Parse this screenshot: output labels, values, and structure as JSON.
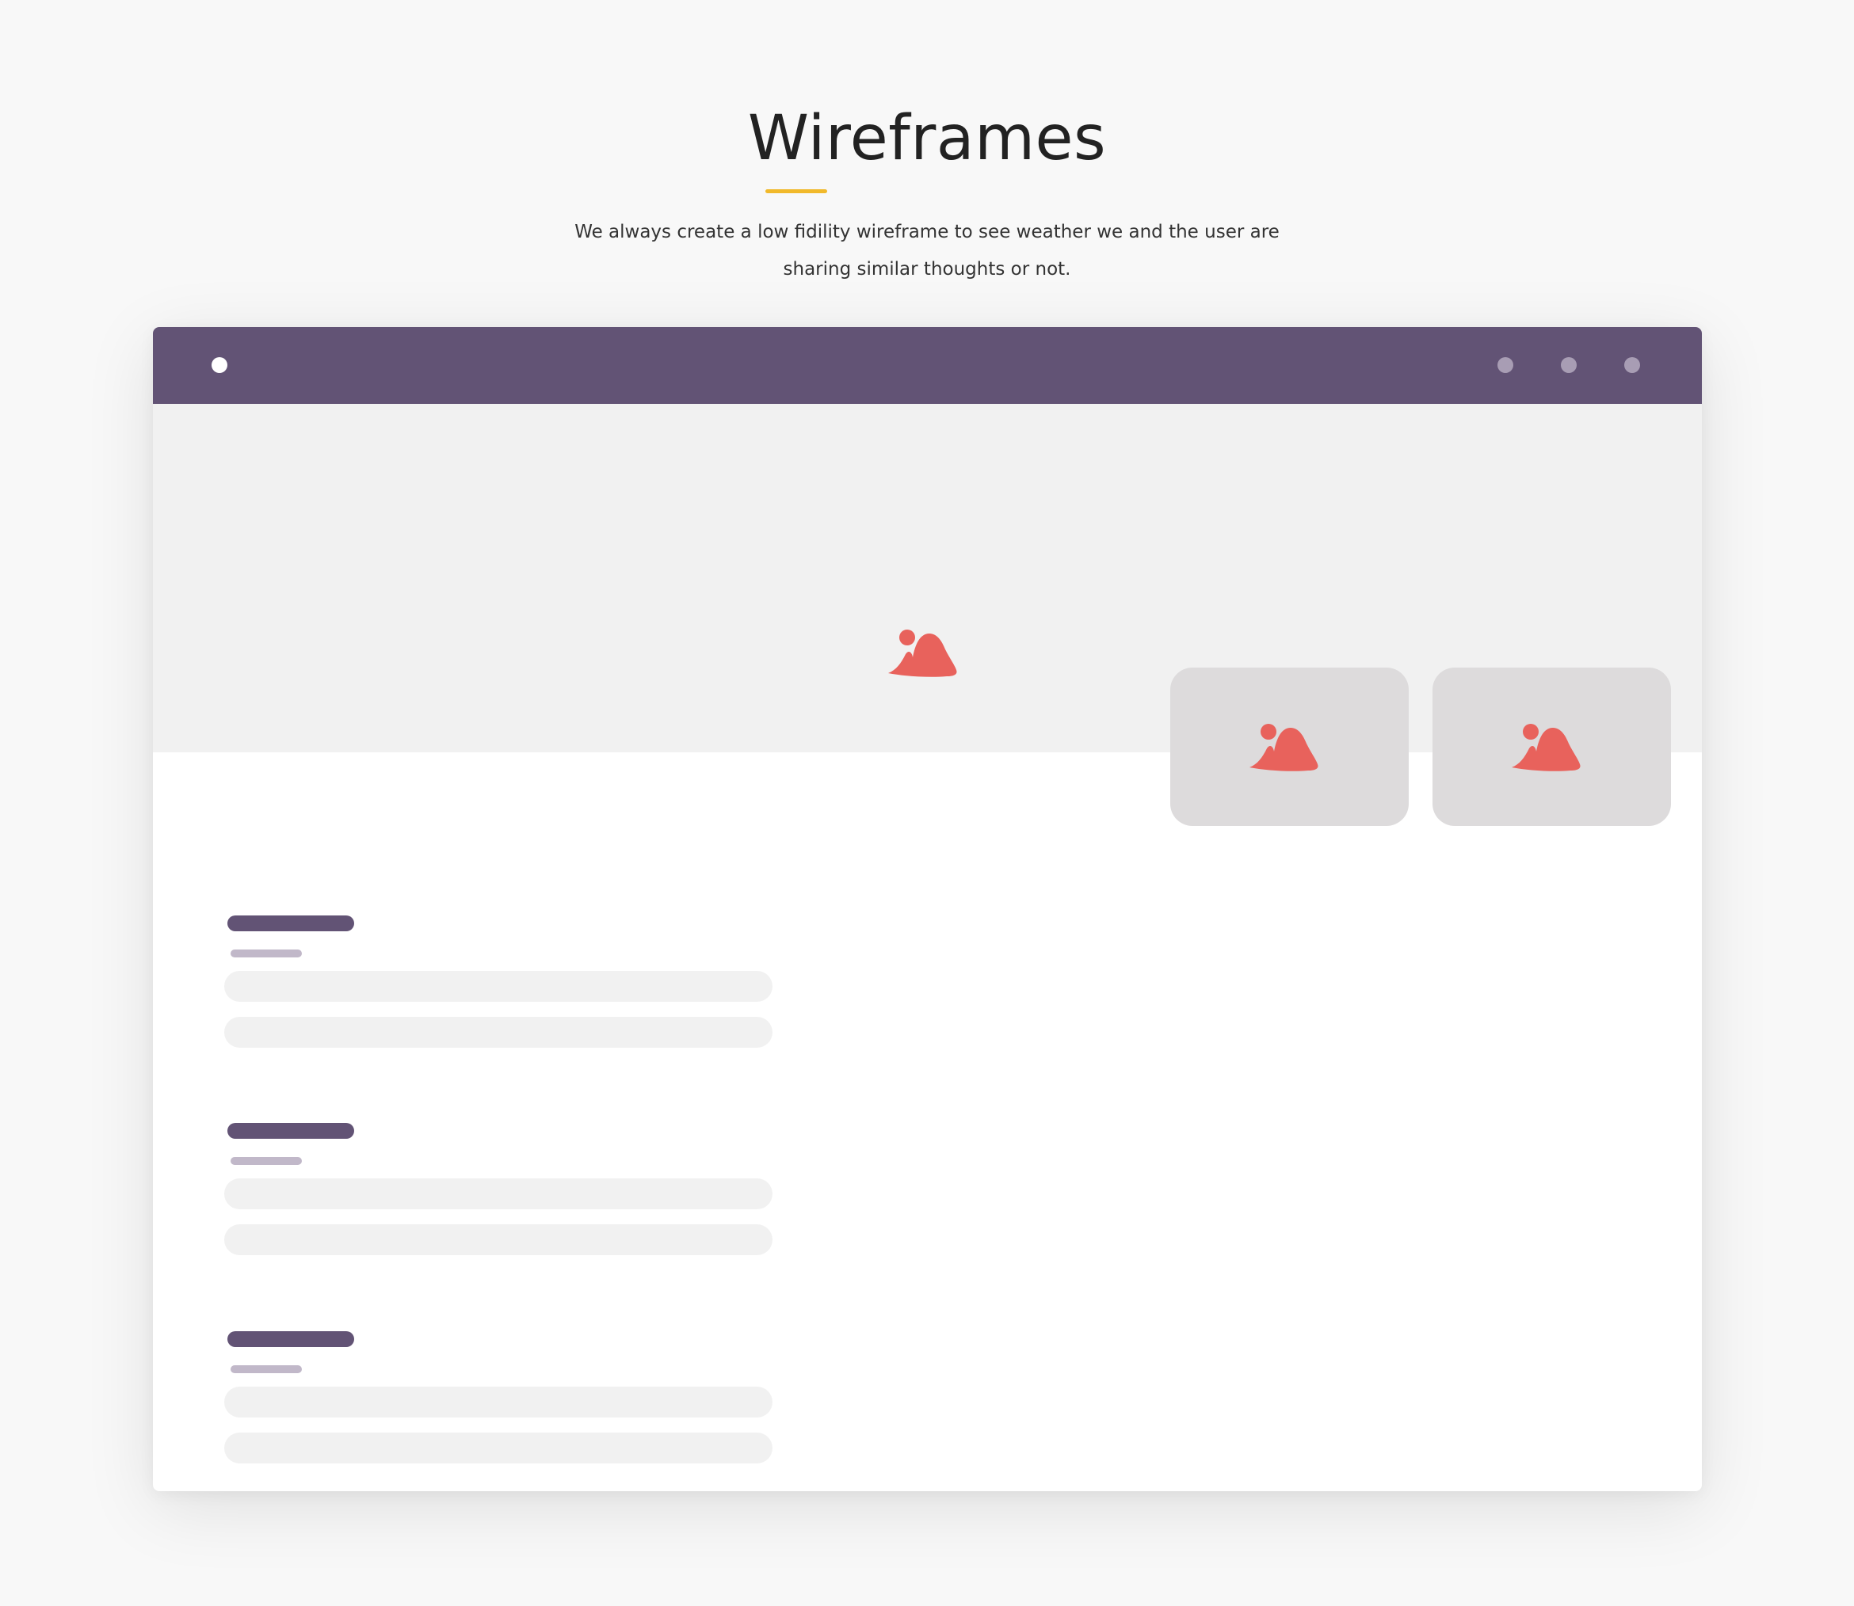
{
  "header": {
    "title": "Wireframes",
    "subtitle_line1": "We always create a low fidility wireframe to see weather we and the user are",
    "subtitle_line2": "sharing similar thoughts or not."
  },
  "icons": {
    "hero": "image-placeholder-icon",
    "thumbnail": "image-placeholder-icon",
    "logo": "circle-dot-icon",
    "nav": "circle-dot-icon"
  },
  "wireframe": {
    "nav_dots": 3,
    "thumbnails": 2,
    "content_blocks": 3
  },
  "colors": {
    "page_background": "#f8f8f8",
    "accent_underline": "#f1b92b",
    "topbar": "#625375",
    "nav_dot": "#a89db4",
    "logo_dot": "#ffffff",
    "hero_background": "#f1f1f1",
    "thumbnail_background": "#dddbdc",
    "image_icon": "#e8625c",
    "title_bar": "#625375",
    "subtitle_bar": "#c1b8c9",
    "text_line": "#f1f1f1"
  }
}
